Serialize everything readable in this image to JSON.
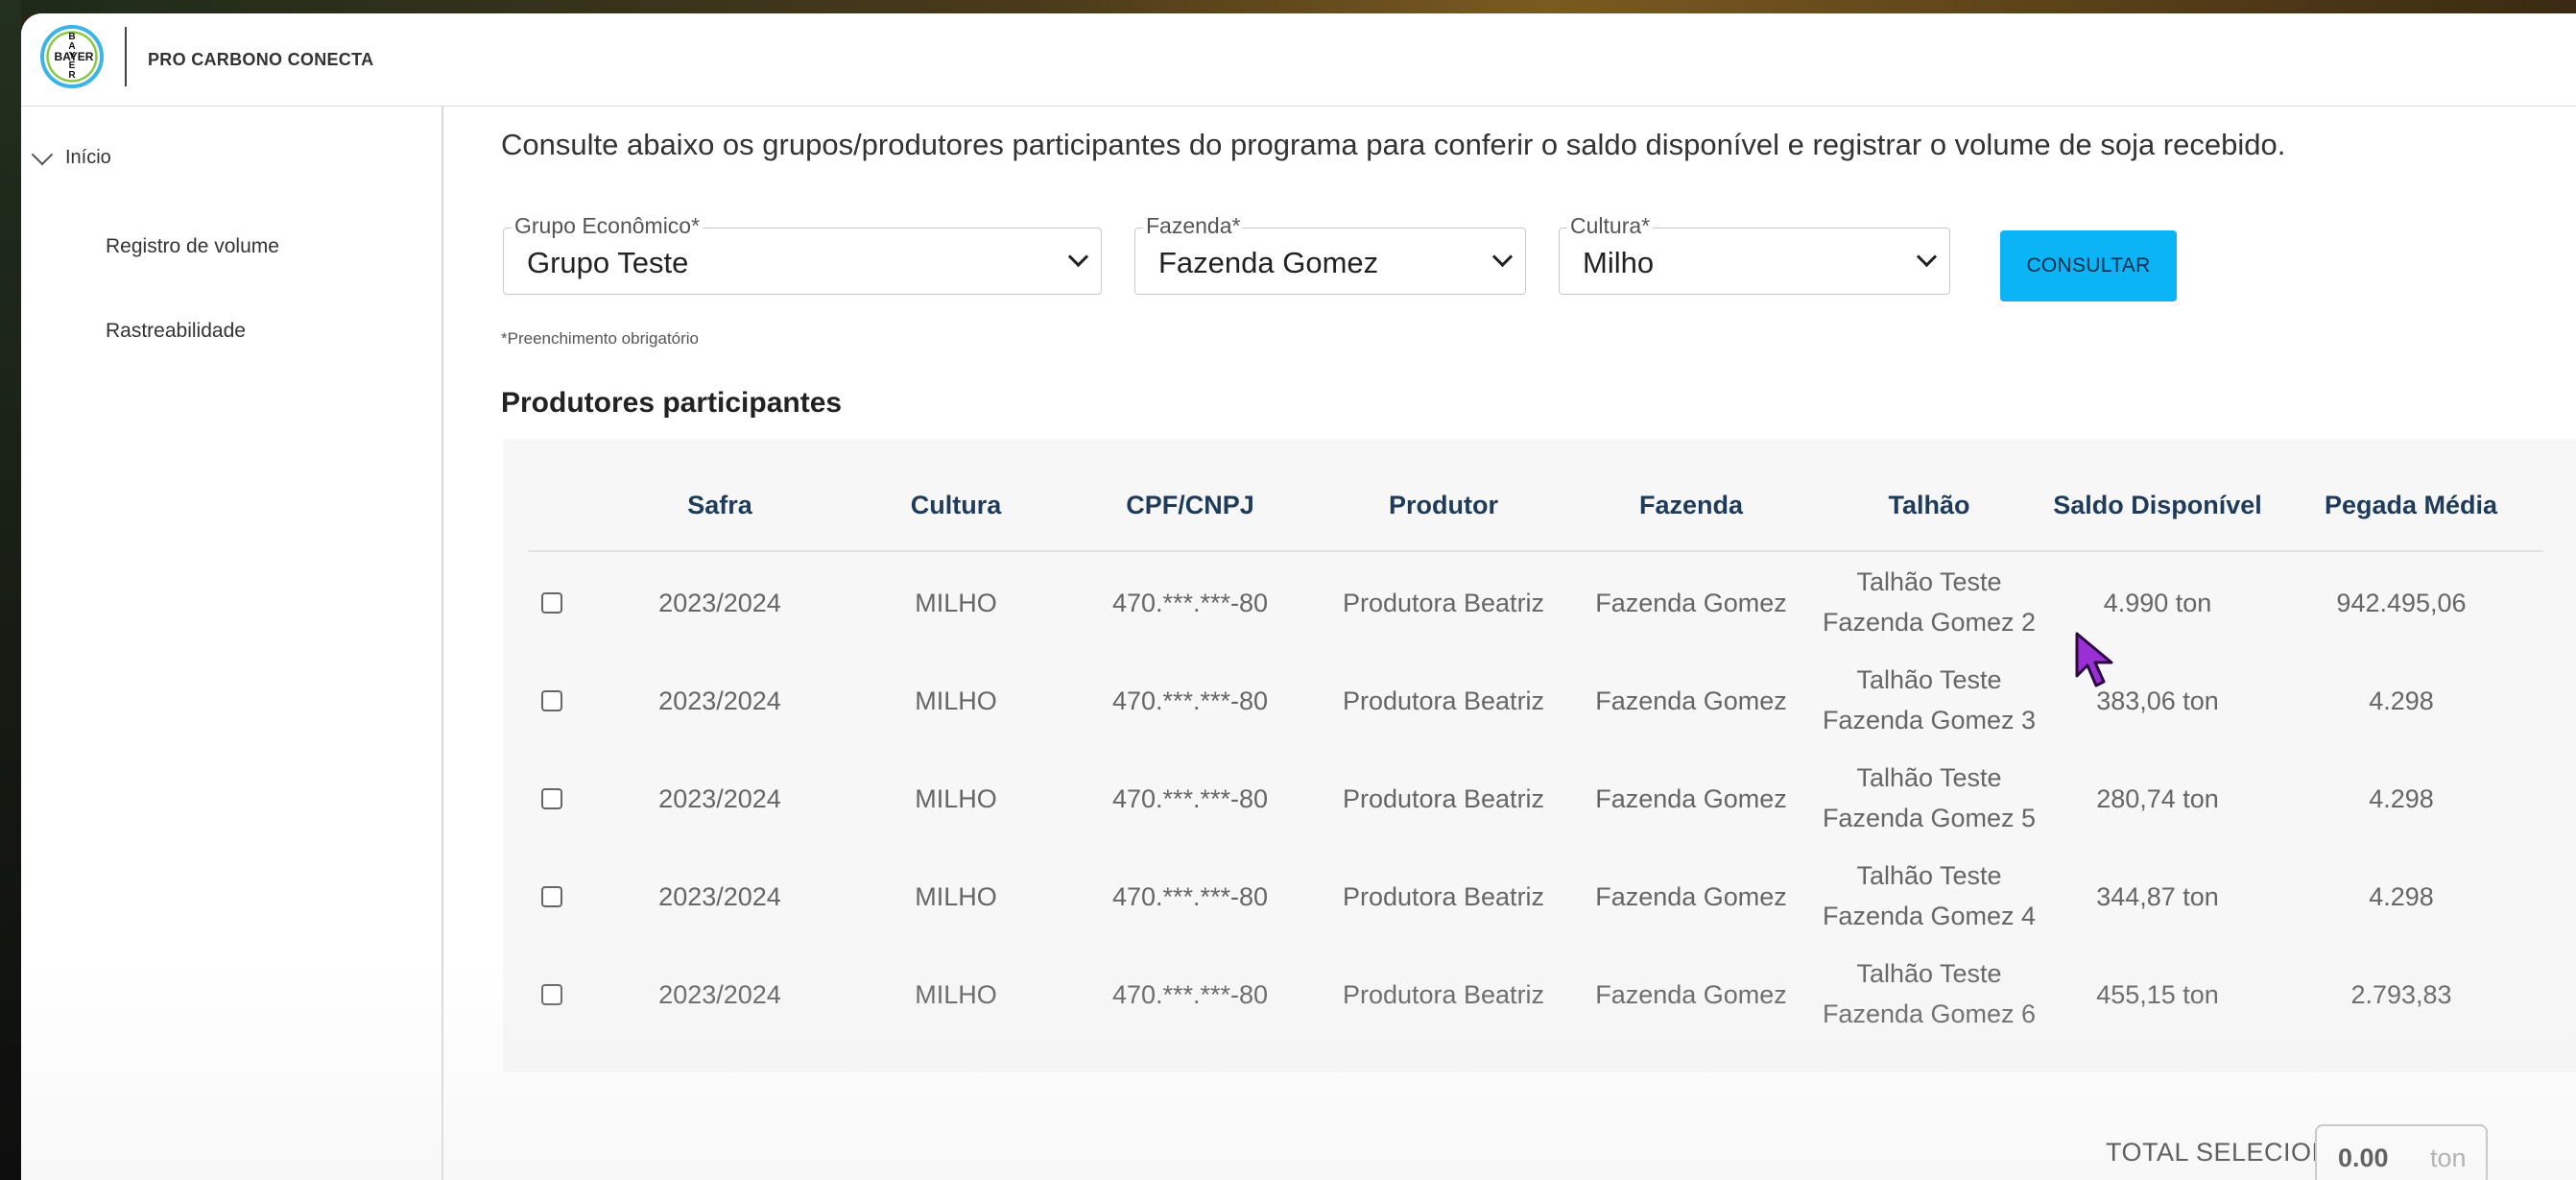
{
  "header": {
    "logo_vertical": "BAYER",
    "logo_horizontal": "BAYER",
    "app_title": "PRO CARBONO CONECTA"
  },
  "sidebar": {
    "top": "Início",
    "items": [
      {
        "label": "Registro de volume"
      },
      {
        "label": "Rastreabilidade"
      }
    ]
  },
  "main": {
    "intro": "Consulte abaixo os grupos/produtores participantes do programa para conferir o saldo disponível e registrar o volume de soja recebido.",
    "filters": {
      "grupo": {
        "label": "Grupo Econômico*",
        "value": "Grupo Teste"
      },
      "fazenda": {
        "label": "Fazenda*",
        "value": "Fazenda Gomez"
      },
      "cultura": {
        "label": "Cultura*",
        "value": "Milho"
      }
    },
    "consult_button": "CONSULTAR",
    "required_hint": "*Preenchimento obrigatório",
    "section_title": "Produtores participantes",
    "table": {
      "headers": [
        "Safra",
        "Cultura",
        "CPF/CNPJ",
        "Produtor",
        "Fazenda",
        "Talhão",
        "Saldo Disponível",
        "Pegada Média"
      ],
      "rows": [
        {
          "safra": "2023/2024",
          "cultura": "MILHO",
          "cpf": "470.***.***-80",
          "produtor": "Produtora Beatriz",
          "fazenda": "Fazenda Gomez",
          "talhao1": "Talhão Teste",
          "talhao2": "Fazenda Gomez 2",
          "saldo": "4.990 ton",
          "pegada": "942.495,06"
        },
        {
          "safra": "2023/2024",
          "cultura": "MILHO",
          "cpf": "470.***.***-80",
          "produtor": "Produtora Beatriz",
          "fazenda": "Fazenda Gomez",
          "talhao1": "Talhão Teste",
          "talhao2": "Fazenda Gomez 3",
          "saldo": "383,06 ton",
          "pegada": "4.298"
        },
        {
          "safra": "2023/2024",
          "cultura": "MILHO",
          "cpf": "470.***.***-80",
          "produtor": "Produtora Beatriz",
          "fazenda": "Fazenda Gomez",
          "talhao1": "Talhão Teste",
          "talhao2": "Fazenda Gomez 5",
          "saldo": "280,74 ton",
          "pegada": "4.298"
        },
        {
          "safra": "2023/2024",
          "cultura": "MILHO",
          "cpf": "470.***.***-80",
          "produtor": "Produtora Beatriz",
          "fazenda": "Fazenda Gomez",
          "talhao1": "Talhão Teste",
          "talhao2": "Fazenda Gomez 4",
          "saldo": "344,87 ton",
          "pegada": "4.298"
        },
        {
          "safra": "2023/2024",
          "cultura": "MILHO",
          "cpf": "470.***.***-80",
          "produtor": "Produtora Beatriz",
          "fazenda": "Fazenda Gomez",
          "talhao1": "Talhão Teste",
          "talhao2": "Fazenda Gomez 6",
          "saldo": "455,15 ton",
          "pegada": "2.793,83"
        }
      ]
    },
    "total": {
      "label": "TOTAL SELECIONADO:",
      "value": "0.00",
      "unit": "ton"
    }
  },
  "colors": {
    "accent": "#0bb4f4",
    "header_text": "#1f3b5a",
    "cursor": "#9b2fd6"
  },
  "icons": {
    "logo": "bayer-cross-logo",
    "sidebar_toggle": "chevron-down-icon",
    "cursor": "mouse-pointer-icon"
  }
}
